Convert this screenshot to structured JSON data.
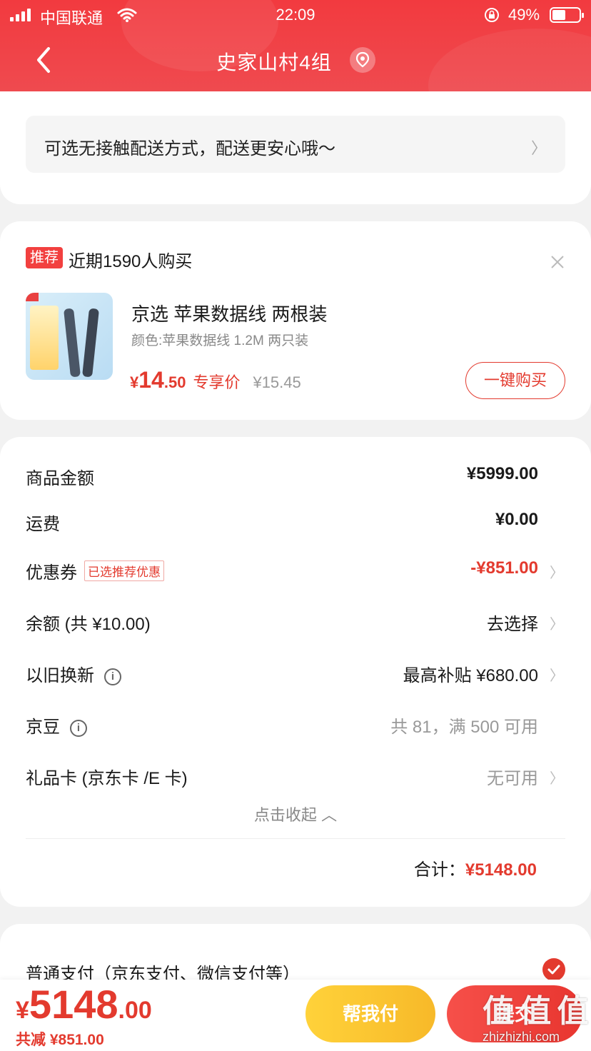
{
  "status_bar": {
    "carrier": "中国联通",
    "time": "22:09",
    "battery": "49%"
  },
  "header": {
    "title": "史家山村4组"
  },
  "delivery": {
    "text": "可选无接触配送方式，配送更安心哦～"
  },
  "recommend": {
    "tag": "推荐",
    "text": "近期1590人购买",
    "product_name": "京选 苹果数据线 两根装",
    "spec": "颜色:苹果数据线 1.2M 两只装",
    "price_yen": "¥",
    "price_int": "14",
    "price_dec": ".50",
    "exclusive": "专享价",
    "original_price": "¥15.45",
    "buy_label": "一键购买"
  },
  "summary": {
    "goods_label": "商品金额",
    "goods_value": "¥5999.00",
    "shipping_label": "运费",
    "shipping_value": "¥0.00",
    "coupon_label": "优惠券",
    "coupon_tag": "已选推荐优惠",
    "coupon_value": "-¥851.00",
    "balance_label": "余额 (共 ¥10.00)",
    "balance_value": "去选择",
    "tradein_label": "以旧换新",
    "tradein_value": "最高补贴 ¥680.00",
    "jingdou_label": "京豆",
    "jingdou_value": "共 81，满 500 可用",
    "giftcard_label": "礼品卡 (京东卡 /E 卡)",
    "giftcard_value": "无可用",
    "collapse_label": "点击收起",
    "total_label": "合计：",
    "total_value": "¥5148.00"
  },
  "payment": {
    "label": "普通支付（京东支付、微信支付等）"
  },
  "bottom_bar": {
    "yen": "¥",
    "int": "5148",
    "dec": ".00",
    "saved": "共减 ¥851.00",
    "help_pay": "帮我付",
    "submit": "提交"
  },
  "watermark": {
    "big": "值 值 值",
    "small": "zhizhizhi.com"
  },
  "colors": {
    "brand_red": "#e33a2e",
    "header_red": "#f23a3f",
    "yellow": "#ffd23a"
  }
}
